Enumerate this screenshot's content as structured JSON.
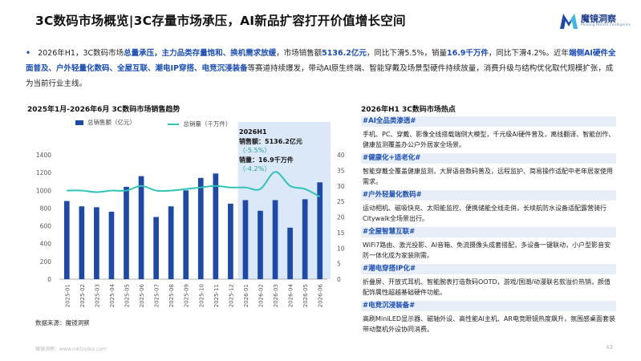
{
  "header": {
    "title": "3C数码市场概览|3C存量市场承压，AI新品扩容打开价值增长空间",
    "logo_text": "魔镜洞察",
    "logo_subtitle": "Moojing Market Intelligence"
  },
  "intro": {
    "bullet": "•",
    "segments": [
      {
        "text": "2026年H1，3C数码市场",
        "hl": false
      },
      {
        "text": "总量承压，主力品类存量饱和、换机需求放缓",
        "hl": true
      },
      {
        "text": "，市场销售额",
        "hl": false
      },
      {
        "text": "5136.2亿元",
        "hl": true
      },
      {
        "text": "，同比下滑5.5%，销量",
        "hl": false
      },
      {
        "text": "16.9千万件",
        "hl": true
      },
      {
        "text": "，同比下滑4.2%。近年",
        "hl": false
      },
      {
        "text": "端侧AI硬件全面普及、户外轻量化数码、全屋互联、潮电IP穿搭、电竞沉浸装备",
        "hl": true
      },
      {
        "text": "等赛道持续爆发，带动AI原生终端、智能穿戴及场景型硬件持续放量，消费升级与结构优化取代规模扩张，成为当前行业主线。",
        "hl": false
      }
    ]
  },
  "chart_data": {
    "type": "bar",
    "title": "2025年1月-2026年6月 3C数码市场销售趋势",
    "categories": [
      "2025-01",
      "2025-02",
      "2025-03",
      "2025-04",
      "2025-05",
      "2025-06",
      "2025-07",
      "2025-08",
      "2025-09",
      "2025-10",
      "2025-11",
      "2025-12",
      "2026-01",
      "2026-02",
      "2026-03",
      "2026-04",
      "2026-05",
      "2026-06"
    ],
    "series": [
      {
        "name": "总销售额（亿元）",
        "type": "bar",
        "axis": "left",
        "color": "#1d4aa8",
        "values": [
          880,
          820,
          810,
          760,
          1040,
          1160,
          700,
          820,
          1000,
          1140,
          1190,
          850,
          890,
          770,
          890,
          580,
          900,
          1090
        ]
      },
      {
        "name": "总销量（千万件）",
        "type": "line",
        "axis": "right",
        "color": "#2ec4b6",
        "values": [
          28.5,
          28.5,
          28,
          28.5,
          28.5,
          30,
          28.5,
          28.5,
          29,
          29.5,
          30,
          29.5,
          29.5,
          29,
          34.5,
          30,
          29,
          26.5
        ]
      }
    ],
    "y_left": {
      "min": 0,
      "max": 1400,
      "ticks": [
        0,
        200,
        400,
        600,
        800,
        1000,
        1200,
        1400
      ]
    },
    "y_right": {
      "min": 0,
      "max": 40,
      "ticks": [
        0,
        5,
        10,
        15,
        20,
        25,
        30,
        35,
        40
      ]
    },
    "highlight_range": [
      "2026-01",
      "2026-06"
    ],
    "grid": false,
    "legend_position": "top"
  },
  "callout": {
    "period": "2026H1",
    "sales_line": "销售额：5136.2亿元",
    "sales_change": "（-5.5%）",
    "volume_line": "销量：16.9千万件",
    "volume_change": "（-4.2%）"
  },
  "source": "数据来源：魔镜洞察",
  "hot": {
    "title": "2026年H1 3C数码市场热点",
    "items": [
      {
        "tag": "#AI全品类渗透#",
        "desc": "手机、PC、穿戴、影像全线搭载端侧大模型，千元级AI硬件普及，离线翻译、智能创作、健康监测覆盖办公户外居家全场景。"
      },
      {
        "tag": "#健康化+适老化#",
        "desc": "智能穿戴全覆盖健康监测，大屏语音数码普及，远程监护、简易操作适配中老年居家使用需求。"
      },
      {
        "tag": "#户外轻量化数码#",
        "desc": "运动相机、磁吸快充、太阳能监控、便携储能全线走俏，长续航防水设备适配露营骑行Citywalk全场景出行。"
      },
      {
        "tag": "#全屋智慧互联#",
        "desc": "WiFi7路由、激光投影、AI音箱、免流摄像头成套搭配，多设备一键联动，小户型影音安防一体化成为家装刚需。"
      },
      {
        "tag": "#潮电穿搭IP化#",
        "desc": "折叠屏、开放式耳机、智能腕表打造数码OOTD，游戏/国潮/动漫联名款溢价热销，颜值配饰属性超越基础硬件功能。"
      },
      {
        "tag": "#电竞沉浸装备#",
        "desc": "高刷MiniLED显示器、磁轴外设、高性能AI主机、AR电竞眼镜热度飙升，氛围感桌面套装带动整机外设协同消费。"
      }
    ]
  },
  "footer": {
    "left": "魔镜洞察：www.mktindex.com",
    "page": "43"
  }
}
